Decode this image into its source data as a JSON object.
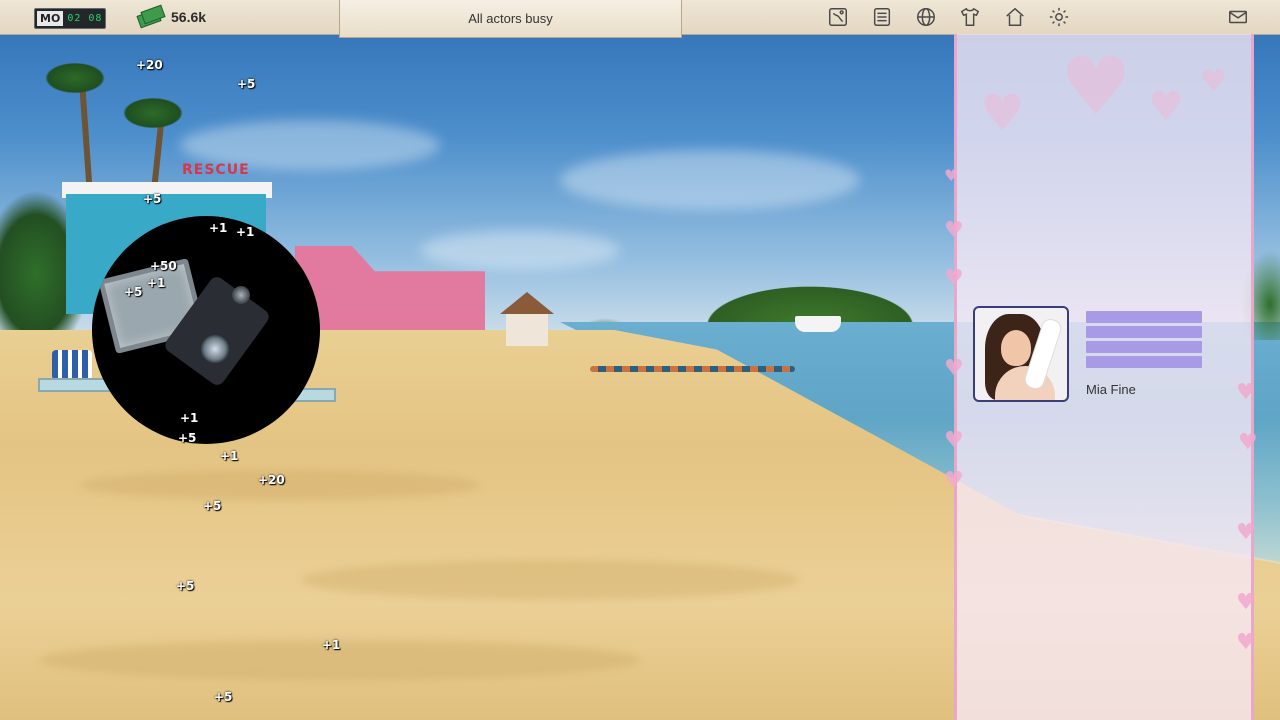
{
  "topbar": {
    "day": "MO",
    "time": "02 08",
    "money": "56.6k",
    "status": "All actors busy",
    "icons": [
      "map-icon",
      "calculator-icon",
      "globe-icon",
      "wardrobe-shirt-icon",
      "home-icon",
      "settings-gear-icon",
      "mail-icon"
    ]
  },
  "floating_texts": [
    "+20",
    "+5",
    "+5",
    "+1",
    "+1",
    "+50",
    "+5",
    "+1",
    "+1",
    "+5",
    "+1",
    "+20",
    "+5",
    "+5",
    "+1",
    "+5"
  ],
  "actors": [
    {
      "name": "Mia Fine",
      "stat_bars": 4
    }
  ],
  "colors": {
    "panel_border": "#e9a8c9",
    "stat_bar": "#a99ae8",
    "clock_digits": "#27d36a"
  }
}
